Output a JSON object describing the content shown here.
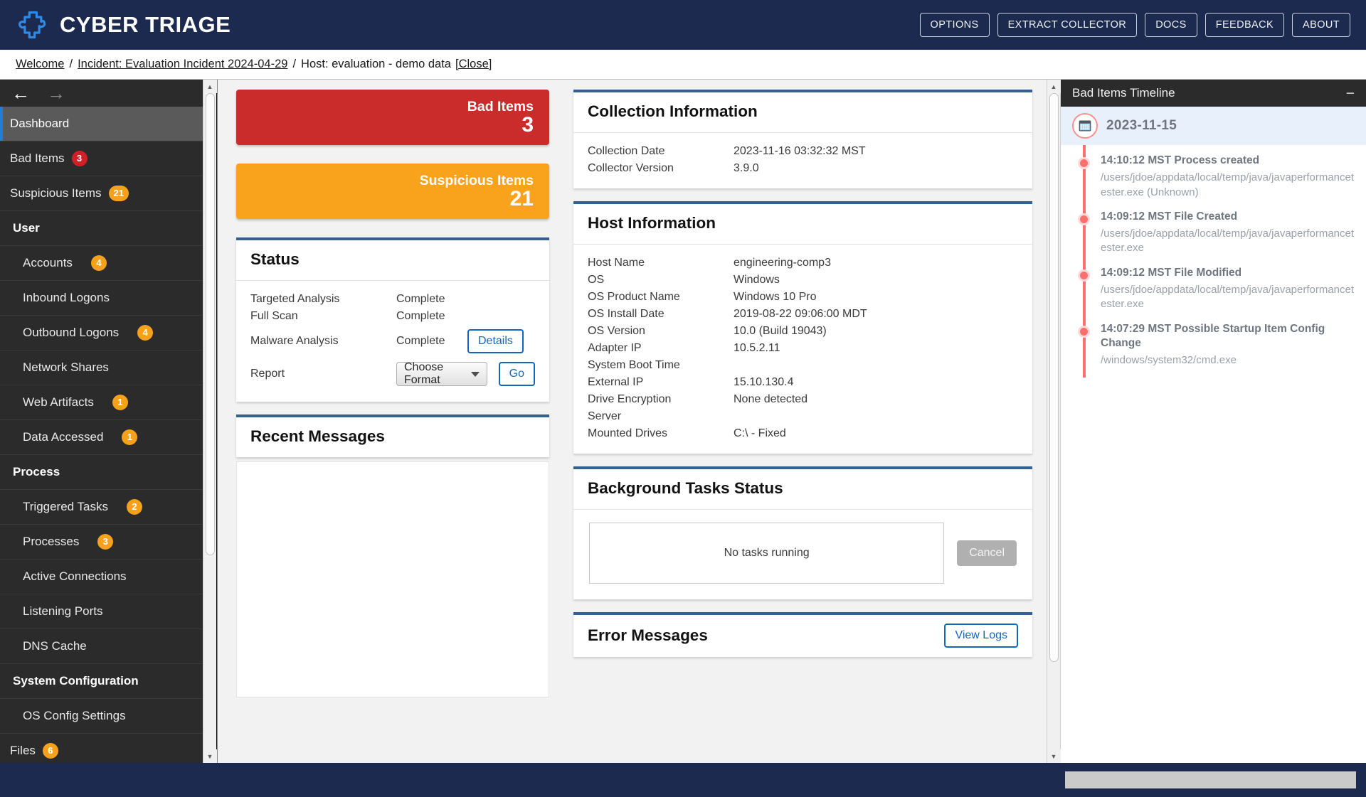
{
  "app": {
    "title": "CYBER TRIAGE",
    "logo_icon": "cyber-triage-logo-icon"
  },
  "topbar": {
    "buttons": [
      {
        "label": "OPTIONS",
        "name": "options-button"
      },
      {
        "label": "EXTRACT COLLECTOR",
        "name": "extract-collector-button"
      },
      {
        "label": "DOCS",
        "name": "docs-button"
      },
      {
        "label": "FEEDBACK",
        "name": "feedback-button"
      },
      {
        "label": "ABOUT",
        "name": "about-button"
      }
    ]
  },
  "breadcrumb": {
    "welcome": "Welcome",
    "sep1": "/",
    "incident": "Incident: Evaluation Incident 2024-04-29",
    "sep2": "/",
    "host": "Host: evaluation - demo data",
    "close": "[Close]"
  },
  "sidebar": {
    "back_icon": "arrow-left-icon",
    "forward_icon": "arrow-right-icon",
    "items": [
      {
        "label": "Dashboard",
        "badge": "",
        "badge_color": "",
        "kind": "top",
        "active": true
      },
      {
        "label": "Bad Items",
        "badge": "3",
        "badge_color": "#cf2027",
        "kind": "top",
        "active": false
      },
      {
        "label": "Suspicious Items",
        "badge": "21",
        "badge_color": "#f5a11c",
        "kind": "top",
        "active": false
      },
      {
        "label": "User",
        "badge": "",
        "badge_color": "",
        "kind": "group",
        "active": false
      },
      {
        "label": "Accounts",
        "badge": "4",
        "badge_color": "#f5a11c",
        "kind": "sub",
        "active": false
      },
      {
        "label": "Inbound Logons",
        "badge": "",
        "badge_color": "",
        "kind": "sub",
        "active": false
      },
      {
        "label": "Outbound Logons",
        "badge": "4",
        "badge_color": "#f5a11c",
        "kind": "sub",
        "active": false
      },
      {
        "label": "Network Shares",
        "badge": "",
        "badge_color": "",
        "kind": "sub",
        "active": false
      },
      {
        "label": "Web Artifacts",
        "badge": "1",
        "badge_color": "#f5a11c",
        "kind": "sub",
        "active": false
      },
      {
        "label": "Data Accessed",
        "badge": "1",
        "badge_color": "#f5a11c",
        "kind": "sub",
        "active": false
      },
      {
        "label": "Process",
        "badge": "",
        "badge_color": "",
        "kind": "group",
        "active": false
      },
      {
        "label": "Triggered Tasks",
        "badge": "2",
        "badge_color": "#f5a11c",
        "kind": "sub",
        "active": false
      },
      {
        "label": "Processes",
        "badge": "3",
        "badge_color": "#f5a11c",
        "kind": "sub",
        "active": false
      },
      {
        "label": "Active Connections",
        "badge": "",
        "badge_color": "",
        "kind": "sub",
        "active": false
      },
      {
        "label": "Listening Ports",
        "badge": "",
        "badge_color": "",
        "kind": "sub",
        "active": false
      },
      {
        "label": "DNS Cache",
        "badge": "",
        "badge_color": "",
        "kind": "sub",
        "active": false
      },
      {
        "label": "System Configuration",
        "badge": "",
        "badge_color": "",
        "kind": "group",
        "active": false
      },
      {
        "label": "OS Config Settings",
        "badge": "",
        "badge_color": "",
        "kind": "sub",
        "active": false
      },
      {
        "label": "Files",
        "badge": "6",
        "badge_color": "#f5a11c",
        "kind": "top",
        "active": false
      }
    ]
  },
  "metrics": {
    "bad": {
      "label": "Bad Items",
      "value": "3",
      "color": "#ca2b2b"
    },
    "suspicious": {
      "label": "Suspicious Items",
      "value": "21",
      "color": "#f9a21b"
    }
  },
  "status_panel": {
    "title": "Status",
    "rows": [
      {
        "label": "Targeted Analysis",
        "value": "Complete"
      },
      {
        "label": "Full Scan",
        "value": "Complete"
      },
      {
        "label": "Malware Analysis",
        "value": "Complete"
      }
    ],
    "details_button": "Details",
    "report_label": "Report",
    "report_format_value": "Choose Format",
    "go_button": "Go"
  },
  "recent_messages": {
    "title": "Recent Messages",
    "body": ""
  },
  "collection_information": {
    "title": "Collection Information",
    "rows": [
      {
        "label": "Collection Date",
        "value": "2023-11-16 03:32:32 MST"
      },
      {
        "label": "Collector Version",
        "value": "3.9.0"
      }
    ]
  },
  "host_information": {
    "title": "Host Information",
    "rows": [
      {
        "label": "Host Name",
        "value": "engineering-comp3"
      },
      {
        "label": "OS",
        "value": "Windows"
      },
      {
        "label": "OS Product Name",
        "value": "Windows 10 Pro"
      },
      {
        "label": "OS Install Date",
        "value": "2019-08-22 09:06:00 MDT"
      },
      {
        "label": "OS Version",
        "value": "10.0 (Build 19043)"
      },
      {
        "label": "Adapter IP",
        "value": "10.5.2.11"
      },
      {
        "label": "System Boot Time",
        "value": ""
      },
      {
        "label": "External IP",
        "value": "15.10.130.4"
      },
      {
        "label": "Drive Encryption",
        "value": "None detected"
      },
      {
        "label": "Server",
        "value": ""
      },
      {
        "label": "Mounted Drives",
        "value": "C:\\ - Fixed"
      }
    ]
  },
  "background_tasks": {
    "title": "Background Tasks Status",
    "empty_text": "No tasks running",
    "cancel_button": "Cancel"
  },
  "error_messages": {
    "title": "Error Messages",
    "view_logs_button": "View Logs"
  },
  "timeline": {
    "title": "Bad Items Timeline",
    "minimize_icon": "minimize-icon",
    "date_icon": "calendar-icon",
    "date": "2023-11-15",
    "events": [
      {
        "title": "14:10:12 MST Process created",
        "detail": "/users/jdoe/appdata/local/temp/java/javaperformancetester.exe (Unknown)"
      },
      {
        "title": "14:09:12 MST File Created",
        "detail": "/users/jdoe/appdata/local/temp/java/javaperformancetester.exe"
      },
      {
        "title": "14:09:12 MST File Modified",
        "detail": "/users/jdoe/appdata/local/temp/java/javaperformancetester.exe"
      },
      {
        "title": "14:07:29 MST Possible Startup Item Config Change",
        "detail": "/windows/system32/cmd.exe"
      }
    ]
  }
}
